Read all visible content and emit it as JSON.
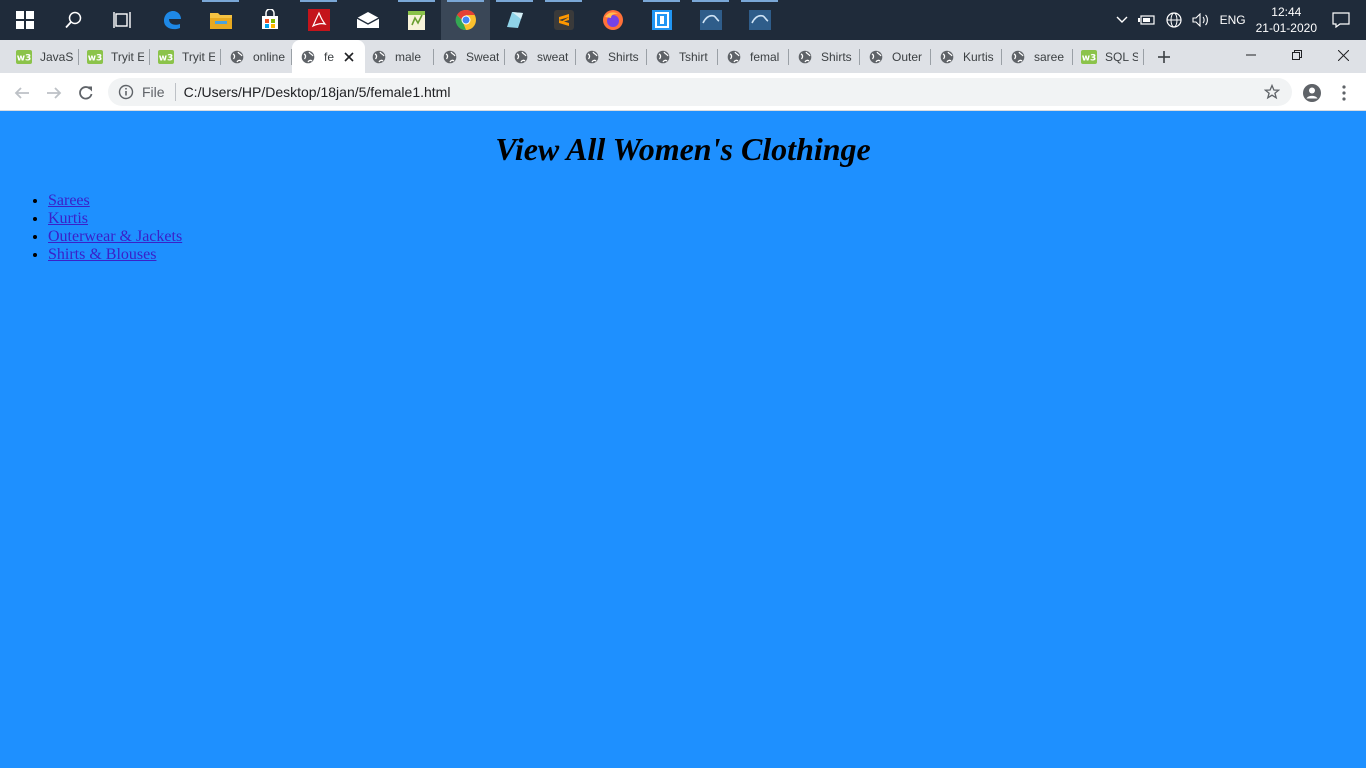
{
  "taskbar": {
    "apps": [
      {
        "name": "start-icon",
        "color": "#ffffff"
      },
      {
        "name": "search-icon",
        "color": "#ffffff"
      },
      {
        "name": "task-view-icon",
        "color": "#ffffff"
      },
      {
        "name": "edge-icon",
        "color": "#1e88e5"
      },
      {
        "name": "file-explorer-icon",
        "color": "#f5c242"
      },
      {
        "name": "store-icon",
        "color": "#ffffff"
      },
      {
        "name": "acrobat-icon",
        "color": "#c4141b"
      },
      {
        "name": "mail-icon",
        "color": "#ffffff"
      },
      {
        "name": "notepad-plus-icon",
        "color": "#8bc34a"
      },
      {
        "name": "chrome-icon",
        "color": "#e44134"
      },
      {
        "name": "app-icon",
        "color": "#8fd3e8"
      },
      {
        "name": "sublime-icon",
        "color": "#ff9800"
      },
      {
        "name": "firefox-icon",
        "color": "#ff7139"
      },
      {
        "name": "app2-icon",
        "color": "#2196f3"
      },
      {
        "name": "mysql-icon",
        "color": "#2f5d8a"
      },
      {
        "name": "mysql-workbench-icon",
        "color": "#2f5d8a"
      }
    ],
    "language": "ENG",
    "time": "12:44",
    "date": "21-01-2020"
  },
  "tabs": [
    {
      "title": "JavaSc",
      "fav": "w3"
    },
    {
      "title": "Tryit E",
      "fav": "w3"
    },
    {
      "title": "Tryit E",
      "fav": "w3"
    },
    {
      "title": "online",
      "fav": "globe"
    },
    {
      "title": "fe",
      "fav": "globe",
      "active": true
    },
    {
      "title": "male",
      "fav": "globe"
    },
    {
      "title": "Sweat",
      "fav": "globe"
    },
    {
      "title": "sweat",
      "fav": "globe"
    },
    {
      "title": "Shirts",
      "fav": "globe"
    },
    {
      "title": "Tshirt",
      "fav": "globe"
    },
    {
      "title": "femal",
      "fav": "globe"
    },
    {
      "title": "Shirts",
      "fav": "globe"
    },
    {
      "title": "Outer",
      "fav": "globe"
    },
    {
      "title": "Kurtis",
      "fav": "globe"
    },
    {
      "title": "saree",
      "fav": "globe"
    },
    {
      "title": "SQL S",
      "fav": "w3"
    }
  ],
  "omnibox": {
    "scheme": "File",
    "url": "C:/Users/HP/Desktop/18jan/5/female1.html"
  },
  "page": {
    "heading": "View All Women's Clothinge",
    "links": [
      "Sarees",
      "Kurtis",
      "Outerwear & Jackets",
      "Shirts & Blouses"
    ],
    "background": "#1e90ff",
    "link_color": "#3a21c9"
  }
}
